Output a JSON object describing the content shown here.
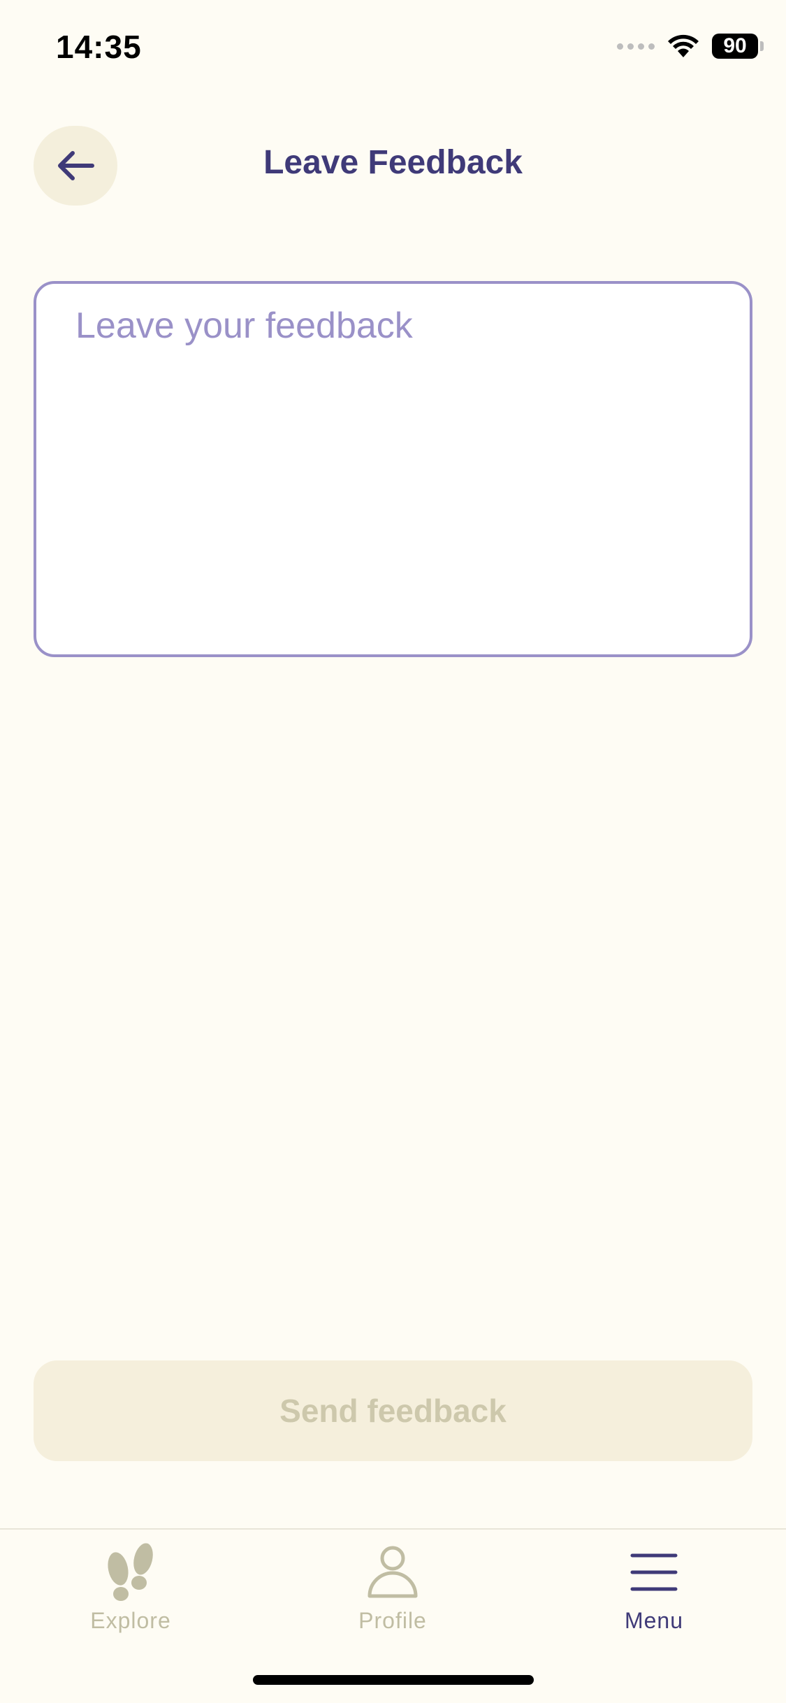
{
  "status_bar": {
    "time": "14:35",
    "battery": "90",
    "icons": [
      "signal-dots-icon",
      "wifi-icon",
      "battery-icon"
    ]
  },
  "header": {
    "title": "Leave Feedback",
    "back_icon": "arrow-left-icon"
  },
  "feedback": {
    "placeholder": "Leave your feedback",
    "value": ""
  },
  "actions": {
    "send_label": "Send feedback",
    "enabled": false
  },
  "tab_bar": {
    "active": "Menu",
    "items": [
      {
        "label": "Explore",
        "icon": "footprints-icon"
      },
      {
        "label": "Profile",
        "icon": "user-icon"
      },
      {
        "label": "Menu",
        "icon": "menu-icon"
      }
    ]
  },
  "colors": {
    "background": "#fefcf4",
    "primary": "#3f3a78",
    "border": "#9a91c8",
    "inactive": "#c0bda3",
    "button_bg": "#f5efdc"
  }
}
